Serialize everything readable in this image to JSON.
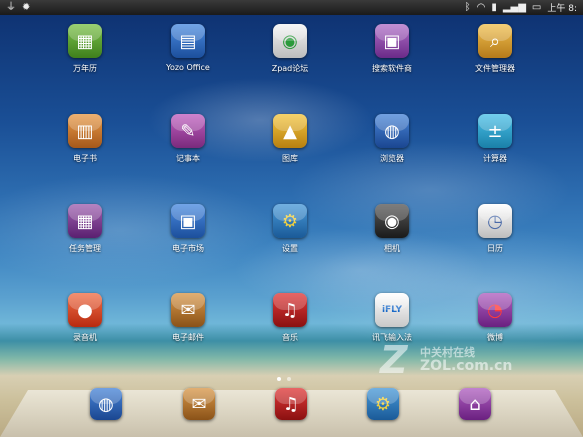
{
  "statusbar": {
    "left_icons": [
      "usb-icon",
      "debug-icon"
    ],
    "right_icons": [
      "bluetooth-icon",
      "wifi-icon",
      "sd-card-icon",
      "signal-icon",
      "battery-icon"
    ],
    "time": "上午 8:"
  },
  "apps": [
    {
      "label": "万年历",
      "icon": "calendar-icon",
      "color": "#5aa02c"
    },
    {
      "label": "Yozo Office",
      "icon": "office-icon",
      "color": "#2f6fc4"
    },
    {
      "label": "Zpad论坛",
      "icon": "forum-icon",
      "color": "#d0d0d0"
    },
    {
      "label": "搜索软件商",
      "icon": "store-bag-icon",
      "color": "#8a4aa8"
    },
    {
      "label": "文件管理器",
      "icon": "folder-search-icon",
      "color": "#d79a2a"
    },
    {
      "label": "电子书",
      "icon": "book-icon",
      "color": "#c9782a"
    },
    {
      "label": "记事本",
      "icon": "notepad-icon",
      "color": "#9b3a9c"
    },
    {
      "label": "图库",
      "icon": "gallery-icon",
      "color": "#d9a020"
    },
    {
      "label": "浏览器",
      "icon": "globe-icon",
      "color": "#2a5fb0"
    },
    {
      "label": "计算器",
      "icon": "calculator-icon",
      "color": "#2aa0c8"
    },
    {
      "label": "任务管理",
      "icon": "task-manager-icon",
      "color": "#7a3a8a"
    },
    {
      "label": "电子市场",
      "icon": "market-bag-icon",
      "color": "#2f6fc4"
    },
    {
      "label": "设置",
      "icon": "gear-icon",
      "color": "#2a7ab8"
    },
    {
      "label": "相机",
      "icon": "camera-icon",
      "color": "#3a3a3a"
    },
    {
      "label": "日历",
      "icon": "clock-calendar-icon",
      "color": "#dadada"
    },
    {
      "label": "录音机",
      "icon": "microphone-icon",
      "color": "#e04020"
    },
    {
      "label": "电子邮件",
      "icon": "mail-icon",
      "color": "#b8762a"
    },
    {
      "label": "音乐",
      "icon": "headphones-icon",
      "color": "#c01a1a"
    },
    {
      "label": "讯飞输入法",
      "icon": "ifly-icon",
      "color": "#e8e8e8"
    },
    {
      "label": "微博",
      "icon": "weibo-icon",
      "color": "#8a3a9a"
    }
  ],
  "dock": [
    {
      "icon": "globe-icon",
      "color": "#2a5fb0"
    },
    {
      "icon": "mail-icon",
      "color": "#b8762a"
    },
    {
      "icon": "headphones-icon",
      "color": "#c01a1a"
    },
    {
      "icon": "gear-icon",
      "color": "#2a7ab8"
    },
    {
      "icon": "home-icon",
      "color": "#8a3a9a"
    }
  ],
  "page_indicator": {
    "pages": 2,
    "current": 1
  },
  "watermark": {
    "mark": "Z",
    "cn": "中关村在线",
    "en": "ZOL.com.cn"
  }
}
